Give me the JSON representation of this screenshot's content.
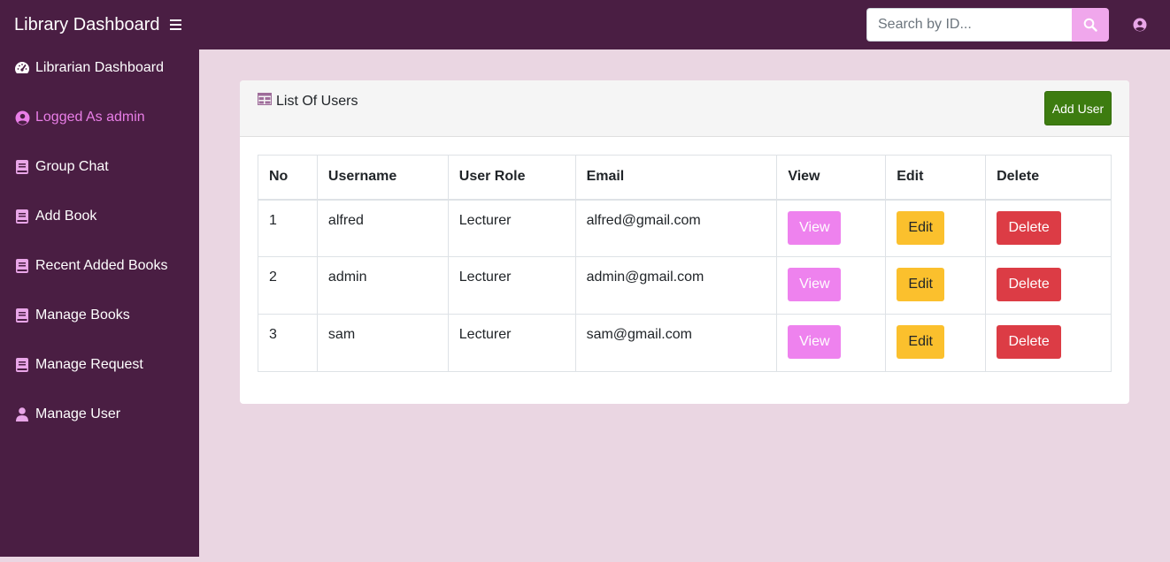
{
  "header": {
    "title": "Library Dashboard",
    "search_placeholder": "Search by ID...",
    "colors": {
      "navbar": "#4a1e43",
      "search_button": "#f0a7ec"
    }
  },
  "sidebar": {
    "items": [
      {
        "label": "Librarian Dashboard",
        "icon": "tachometer-icon"
      },
      {
        "label": "Logged As admin",
        "icon": "user-circle-icon",
        "active": true
      },
      {
        "label": "Group Chat",
        "icon": "book-icon"
      },
      {
        "label": "Add Book",
        "icon": "book-icon"
      },
      {
        "label": "Recent Added Books",
        "icon": "book-icon"
      },
      {
        "label": "Manage Books",
        "icon": "book-icon"
      },
      {
        "label": "Manage Request",
        "icon": "book-icon"
      },
      {
        "label": "Manage User",
        "icon": "user-icon"
      }
    ]
  },
  "card": {
    "title": "List Of Users",
    "add_button": "Add User",
    "table": {
      "headers": [
        "No",
        "Username",
        "User Role",
        "Email",
        "View",
        "Edit",
        "Delete"
      ],
      "rows": [
        {
          "no": "1",
          "username": "alfred",
          "role": "Lecturer",
          "email": "alfred@gmail.com",
          "view": "View",
          "edit": "Edit",
          "delete": "Delete"
        },
        {
          "no": "2",
          "username": "admin",
          "role": "Lecturer",
          "email": "admin@gmail.com",
          "view": "View",
          "edit": "Edit",
          "delete": "Delete"
        },
        {
          "no": "3",
          "username": "sam",
          "role": "Lecturer",
          "email": "sam@gmail.com",
          "view": "View",
          "edit": "Edit",
          "delete": "Delete"
        }
      ]
    }
  }
}
